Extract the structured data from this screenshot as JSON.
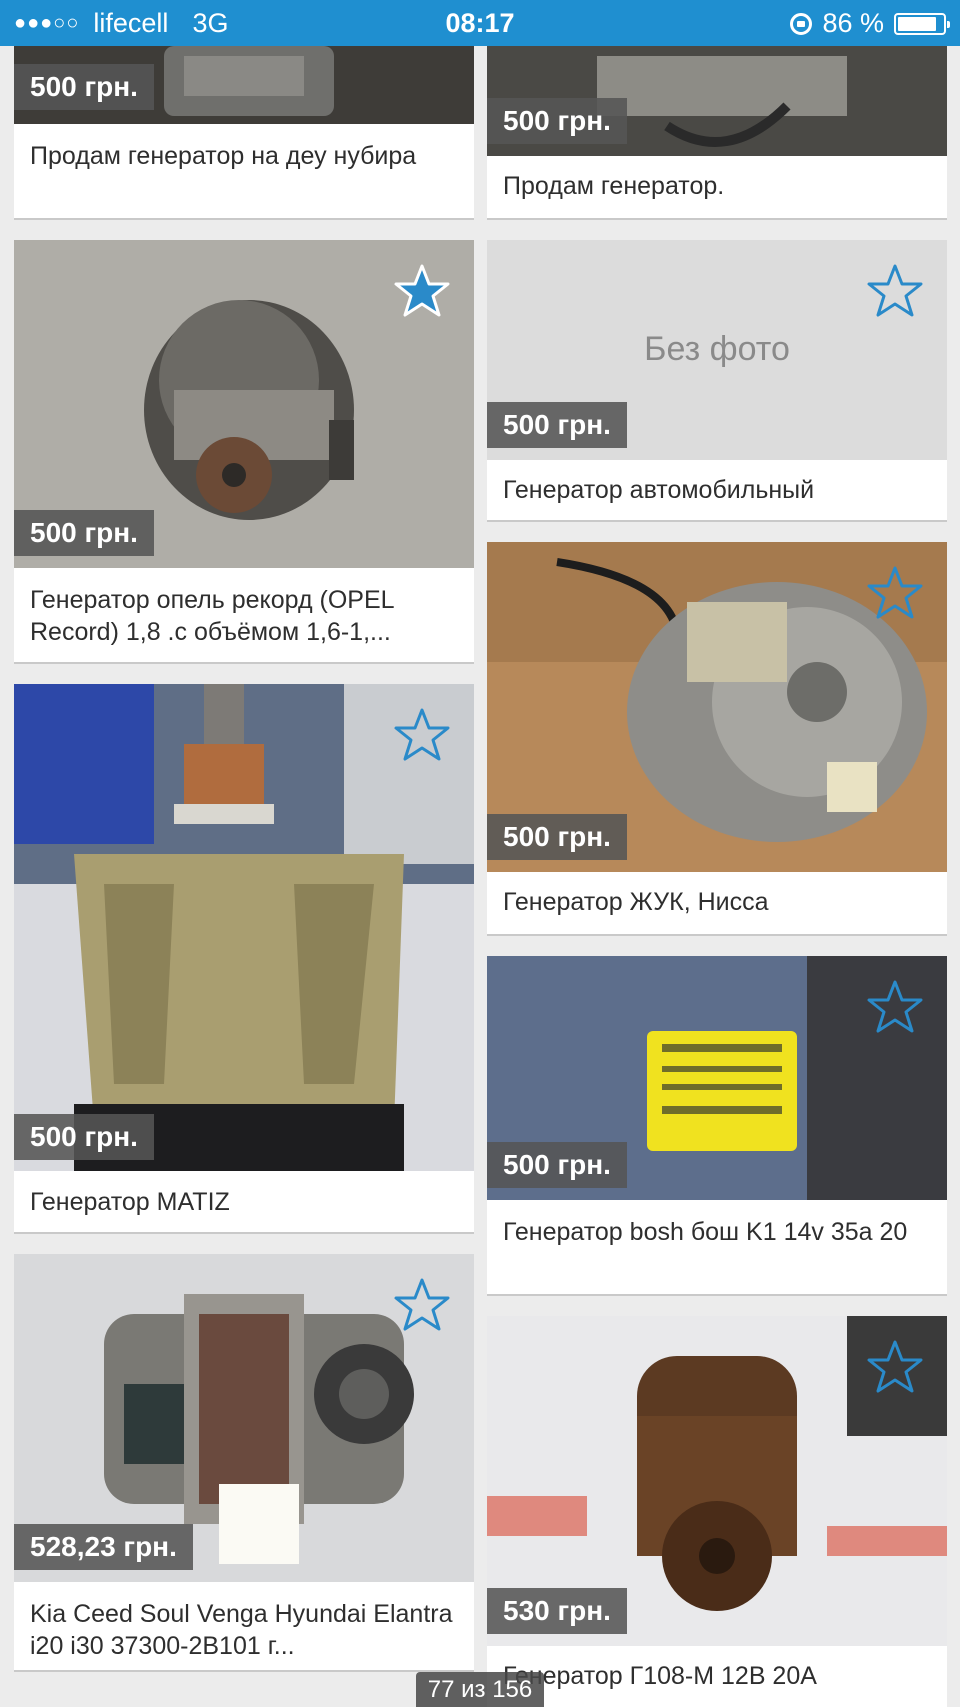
{
  "status_bar": {
    "carrier": "lifecell",
    "network": "3G",
    "time": "08:17",
    "battery": "86 %",
    "battery_level": 0.86,
    "signal_icon": "signal-dots-icon",
    "lock_icon": "rotation-lock-icon"
  },
  "colors": {
    "accent": "#1f8fd0",
    "star_fill": "#2a8ac9",
    "price_badge": "#555555"
  },
  "listings": [
    {
      "price": "500 грн.",
      "title": "Продам генератор на деу нубира",
      "starred": false
    },
    {
      "price": "500 грн.",
      "title": "Продам генератор.",
      "starred": false
    },
    {
      "price": "500 грн.",
      "title": "Генератор опель рекорд (OPEL Record) 1,8 .с объёмом 1,6-1,...",
      "starred": true
    },
    {
      "price": "500 грн.",
      "title": "Генератор автомобильный",
      "starred": false,
      "no_photo_label": "Без фото"
    },
    {
      "price": "500 грн.",
      "title": "Генератор MATIZ",
      "starred": false
    },
    {
      "price": "500 грн.",
      "title": "Генератор ЖУК, Нисса",
      "starred": false
    },
    {
      "price": "528,23 грн.",
      "title": "Kia Ceed Soul Venga Hyundai Elantra i20 i30 37300-2B101 г...",
      "starred": false
    },
    {
      "price": "500 грн.",
      "title": "Генератор bosh бош K1 14v 35а 20",
      "starred": false
    },
    {
      "price": "530 грн.",
      "title": "Генератор Г108-М 12В 20А",
      "starred": false
    }
  ],
  "pagination": "77 из 156"
}
